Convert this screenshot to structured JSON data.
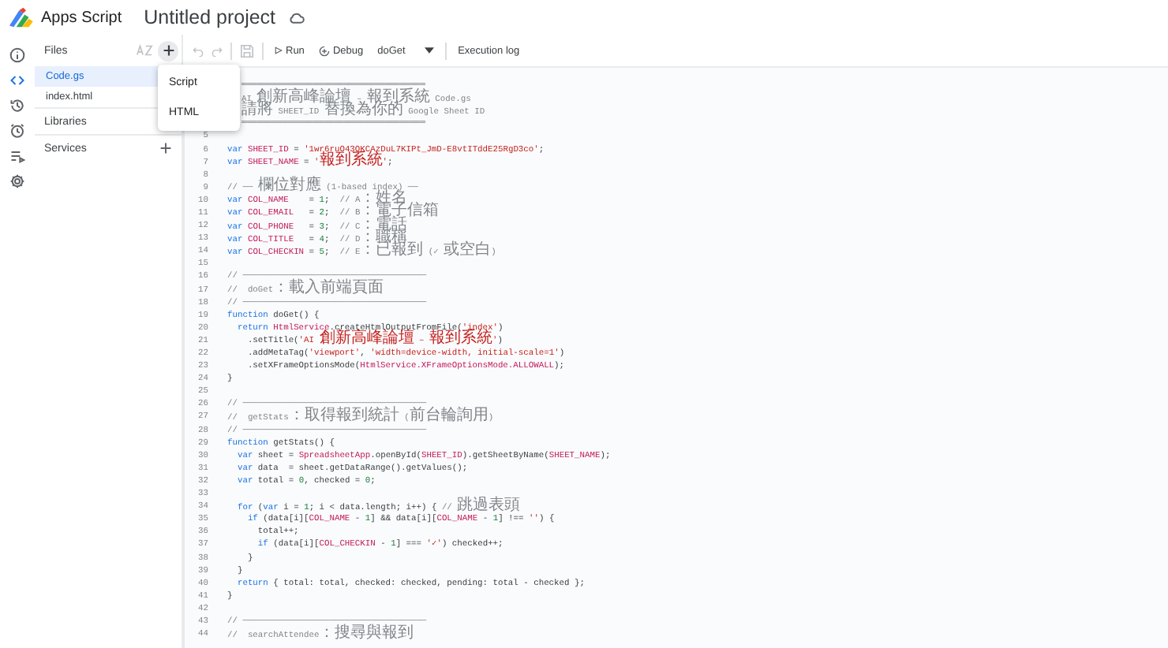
{
  "header": {
    "app_name": "Apps Script",
    "project_title": "Untitled project"
  },
  "rail": [
    {
      "kind": "info",
      "selected": false
    },
    {
      "kind": "code",
      "selected": true
    },
    {
      "kind": "history",
      "selected": false
    },
    {
      "kind": "triggers",
      "selected": false
    },
    {
      "kind": "executions",
      "selected": false
    },
    {
      "kind": "settings",
      "selected": false
    }
  ],
  "files_panel": {
    "title": "Files",
    "files": [
      {
        "name": "Code.gs",
        "selected": true
      },
      {
        "name": "index.html",
        "selected": false
      }
    ],
    "sections": [
      {
        "label": "Libraries"
      },
      {
        "label": "Services",
        "addable": true
      }
    ]
  },
  "add_menu": {
    "items": [
      "Script",
      "HTML"
    ]
  },
  "toolbar": {
    "run": "Run",
    "debug": "Debug",
    "function": "doGet",
    "execution_log": "Execution log"
  },
  "editor": {
    "lines": [
      {
        "tokens": [
          {
            "kind": "comment",
            "text": "════════════════════════════════════"
          }
        ]
      },
      {
        "tokens": [
          {
            "kind": "comment",
            "text": "AI 創新高峰論壇 – 報到系統 Code.gs"
          }
        ]
      },
      {
        "tokens": [
          {
            "kind": "comment",
            "text": "請將 SHEET_ID 替換為你的 Google Sheet ID"
          }
        ]
      },
      {
        "tokens": [
          {
            "kind": "comment",
            "text": "════════════════════════════════════"
          }
        ]
      },
      {
        "number": "5"
      },
      {
        "number": "6",
        "tokens": [
          {
            "kind": "keyword",
            "text": "var "
          },
          {
            "kind": "ident",
            "text": "SHEET_ID"
          },
          {
            "kind": "plain",
            "text": " = "
          },
          {
            "kind": "string",
            "text": "'1wr6ruO43OKCAzDuL7KIPt_JmD-E8vtITddE25RgD3co'"
          },
          {
            "kind": "plain",
            "text": ";"
          }
        ]
      },
      {
        "number": "7",
        "tokens": [
          {
            "kind": "keyword",
            "text": "var "
          },
          {
            "kind": "ident",
            "text": "SHEET_NAME"
          },
          {
            "kind": "plain",
            "text": " = "
          },
          {
            "kind": "string",
            "text": "'報到系統'"
          },
          {
            "kind": "plain",
            "text": ";"
          }
        ]
      },
      {
        "number": "8"
      },
      {
        "number": "9",
        "tokens": [
          {
            "kind": "comment",
            "text": "// ── 欄位對應 (1-based index) ──"
          }
        ]
      },
      {
        "number": "10",
        "tokens": [
          {
            "kind": "keyword",
            "text": "var "
          },
          {
            "kind": "ident",
            "text": "COL_NAME"
          },
          {
            "kind": "plain",
            "text": "    = "
          },
          {
            "kind": "number",
            "text": "1"
          },
          {
            "kind": "plain",
            "text": ";  "
          },
          {
            "kind": "comment",
            "text": "// A：姓名"
          }
        ]
      },
      {
        "number": "11",
        "tokens": [
          {
            "kind": "keyword",
            "text": "var "
          },
          {
            "kind": "ident",
            "text": "COL_EMAIL"
          },
          {
            "kind": "plain",
            "text": "   = "
          },
          {
            "kind": "number",
            "text": "2"
          },
          {
            "kind": "plain",
            "text": ";  "
          },
          {
            "kind": "comment",
            "text": "// B：電子信箱"
          }
        ]
      },
      {
        "number": "12",
        "tokens": [
          {
            "kind": "keyword",
            "text": "var "
          },
          {
            "kind": "ident",
            "text": "COL_PHONE"
          },
          {
            "kind": "plain",
            "text": "   = "
          },
          {
            "kind": "number",
            "text": "3"
          },
          {
            "kind": "plain",
            "text": ";  "
          },
          {
            "kind": "comment",
            "text": "// C：電話"
          }
        ]
      },
      {
        "number": "13",
        "tokens": [
          {
            "kind": "keyword",
            "text": "var "
          },
          {
            "kind": "ident",
            "text": "COL_TITLE"
          },
          {
            "kind": "plain",
            "text": "   = "
          },
          {
            "kind": "number",
            "text": "4"
          },
          {
            "kind": "plain",
            "text": ";  "
          },
          {
            "kind": "comment",
            "text": "// D：職稱"
          }
        ]
      },
      {
        "number": "14",
        "tokens": [
          {
            "kind": "keyword",
            "text": "var "
          },
          {
            "kind": "ident",
            "text": "COL_CHECKIN"
          },
          {
            "kind": "plain",
            "text": " = "
          },
          {
            "kind": "number",
            "text": "5"
          },
          {
            "kind": "plain",
            "text": ";  "
          },
          {
            "kind": "comment",
            "text": "// E：已報到 (✓ 或空白)"
          }
        ]
      },
      {
        "number": "15"
      },
      {
        "number": "16",
        "tokens": [
          {
            "kind": "comment",
            "text": "// ────────────────────────────────────"
          }
        ]
      },
      {
        "number": "17",
        "tokens": [
          {
            "kind": "comment",
            "text": "//  doGet：載入前端頁面"
          }
        ]
      },
      {
        "number": "18",
        "tokens": [
          {
            "kind": "comment",
            "text": "// ────────────────────────────────────"
          }
        ]
      },
      {
        "number": "19",
        "tokens": [
          {
            "kind": "keyword",
            "text": "function"
          },
          {
            "kind": "plain",
            "text": " doGet() {"
          }
        ]
      },
      {
        "number": "20",
        "tokens": [
          {
            "kind": "keyword",
            "text": "  return "
          },
          {
            "kind": "ident",
            "text": "HtmlService"
          },
          {
            "kind": "plain",
            "text": ".createHtmlOutputFromFile("
          },
          {
            "kind": "string",
            "text": "'index'"
          },
          {
            "kind": "plain",
            "text": ")"
          }
        ]
      },
      {
        "number": "21",
        "tokens": [
          {
            "kind": "plain",
            "text": "    .setTitle("
          },
          {
            "kind": "string",
            "text": "'AI 創新高峰論壇 – 報到系統'"
          },
          {
            "kind": "plain",
            "text": ")"
          }
        ]
      },
      {
        "number": "22",
        "tokens": [
          {
            "kind": "plain",
            "text": "    .addMetaTag("
          },
          {
            "kind": "string",
            "text": "'viewport'"
          },
          {
            "kind": "plain",
            "text": ", "
          },
          {
            "kind": "string",
            "text": "'width=device-width, initial-scale=1'"
          },
          {
            "kind": "plain",
            "text": ")"
          }
        ]
      },
      {
        "number": "23",
        "tokens": [
          {
            "kind": "plain",
            "text": "    .setXFrameOptionsMode("
          },
          {
            "kind": "ident",
            "text": "HtmlService.XFrameOptionsMode.ALLOWALL"
          },
          {
            "kind": "plain",
            "text": ");"
          }
        ]
      },
      {
        "number": "24",
        "tokens": [
          {
            "kind": "plain",
            "text": "}"
          }
        ]
      },
      {
        "number": "25"
      },
      {
        "number": "26",
        "tokens": [
          {
            "kind": "comment",
            "text": "// ────────────────────────────────────"
          }
        ]
      },
      {
        "number": "27",
        "tokens": [
          {
            "kind": "comment",
            "text": "//  getStats：取得報到統計 (前台輪詢用)"
          }
        ]
      },
      {
        "number": "28",
        "tokens": [
          {
            "kind": "comment",
            "text": "// ────────────────────────────────────"
          }
        ]
      },
      {
        "number": "29",
        "tokens": [
          {
            "kind": "keyword",
            "text": "function"
          },
          {
            "kind": "plain",
            "text": " getStats() {"
          }
        ]
      },
      {
        "number": "30",
        "tokens": [
          {
            "kind": "keyword",
            "text": "  var"
          },
          {
            "kind": "plain",
            "text": " sheet = "
          },
          {
            "kind": "ident",
            "text": "SpreadsheetApp"
          },
          {
            "kind": "plain",
            "text": ".openById("
          },
          {
            "kind": "ident",
            "text": "SHEET_ID"
          },
          {
            "kind": "plain",
            "text": ").getSheetByName("
          },
          {
            "kind": "ident",
            "text": "SHEET_NAME"
          },
          {
            "kind": "plain",
            "text": ");"
          }
        ]
      },
      {
        "number": "31",
        "tokens": [
          {
            "kind": "keyword",
            "text": "  var"
          },
          {
            "kind": "plain",
            "text": " data  = sheet.getDataRange().getValues();"
          }
        ]
      },
      {
        "number": "32",
        "tokens": [
          {
            "kind": "keyword",
            "text": "  var"
          },
          {
            "kind": "plain",
            "text": " total = "
          },
          {
            "kind": "number",
            "text": "0"
          },
          {
            "kind": "plain",
            "text": ", checked = "
          },
          {
            "kind": "number",
            "text": "0"
          },
          {
            "kind": "plain",
            "text": ";"
          }
        ]
      },
      {
        "number": "33"
      },
      {
        "number": "34",
        "tokens": [
          {
            "kind": "keyword",
            "text": "  for"
          },
          {
            "kind": "plain",
            "text": " ("
          },
          {
            "kind": "keyword",
            "text": "var"
          },
          {
            "kind": "plain",
            "text": " i = "
          },
          {
            "kind": "number",
            "text": "1"
          },
          {
            "kind": "plain",
            "text": "; i < data.length; i++) { "
          },
          {
            "kind": "comment",
            "text": "// 跳過表頭"
          }
        ]
      },
      {
        "number": "35",
        "tokens": [
          {
            "kind": "keyword",
            "text": "    if"
          },
          {
            "kind": "plain",
            "text": " (data[i]["
          },
          {
            "kind": "ident",
            "text": "COL_NAME"
          },
          {
            "kind": "plain",
            "text": " - "
          },
          {
            "kind": "number",
            "text": "1"
          },
          {
            "kind": "plain",
            "text": "] && data[i]["
          },
          {
            "kind": "ident",
            "text": "COL_NAME"
          },
          {
            "kind": "plain",
            "text": " - "
          },
          {
            "kind": "number",
            "text": "1"
          },
          {
            "kind": "plain",
            "text": "] !== "
          },
          {
            "kind": "string",
            "text": "''"
          },
          {
            "kind": "plain",
            "text": ") {"
          }
        ]
      },
      {
        "number": "36",
        "tokens": [
          {
            "kind": "plain",
            "text": "      total++;"
          }
        ]
      },
      {
        "number": "37",
        "tokens": [
          {
            "kind": "keyword",
            "text": "      if"
          },
          {
            "kind": "plain",
            "text": " (data[i]["
          },
          {
            "kind": "ident",
            "text": "COL_CHECKIN"
          },
          {
            "kind": "plain",
            "text": " - "
          },
          {
            "kind": "number",
            "text": "1"
          },
          {
            "kind": "plain",
            "text": "] === "
          },
          {
            "kind": "string",
            "text": "'✓'"
          },
          {
            "kind": "plain",
            "text": ") checked++;"
          }
        ]
      },
      {
        "number": "38",
        "tokens": [
          {
            "kind": "plain",
            "text": "    }"
          }
        ]
      },
      {
        "number": "39",
        "tokens": [
          {
            "kind": "plain",
            "text": "  }"
          }
        ]
      },
      {
        "number": "40",
        "tokens": [
          {
            "kind": "keyword",
            "text": "  return"
          },
          {
            "kind": "plain",
            "text": " { total: total, checked: checked, pending: total - checked };"
          }
        ]
      },
      {
        "number": "41",
        "tokens": [
          {
            "kind": "plain",
            "text": "}"
          }
        ]
      },
      {
        "number": "42"
      },
      {
        "number": "43",
        "tokens": [
          {
            "kind": "comment",
            "text": "// ────────────────────────────────────"
          }
        ]
      },
      {
        "number": "44",
        "tokens": [
          {
            "kind": "comment",
            "text": "//  searchAttendee：搜尋與報到"
          }
        ]
      }
    ]
  }
}
